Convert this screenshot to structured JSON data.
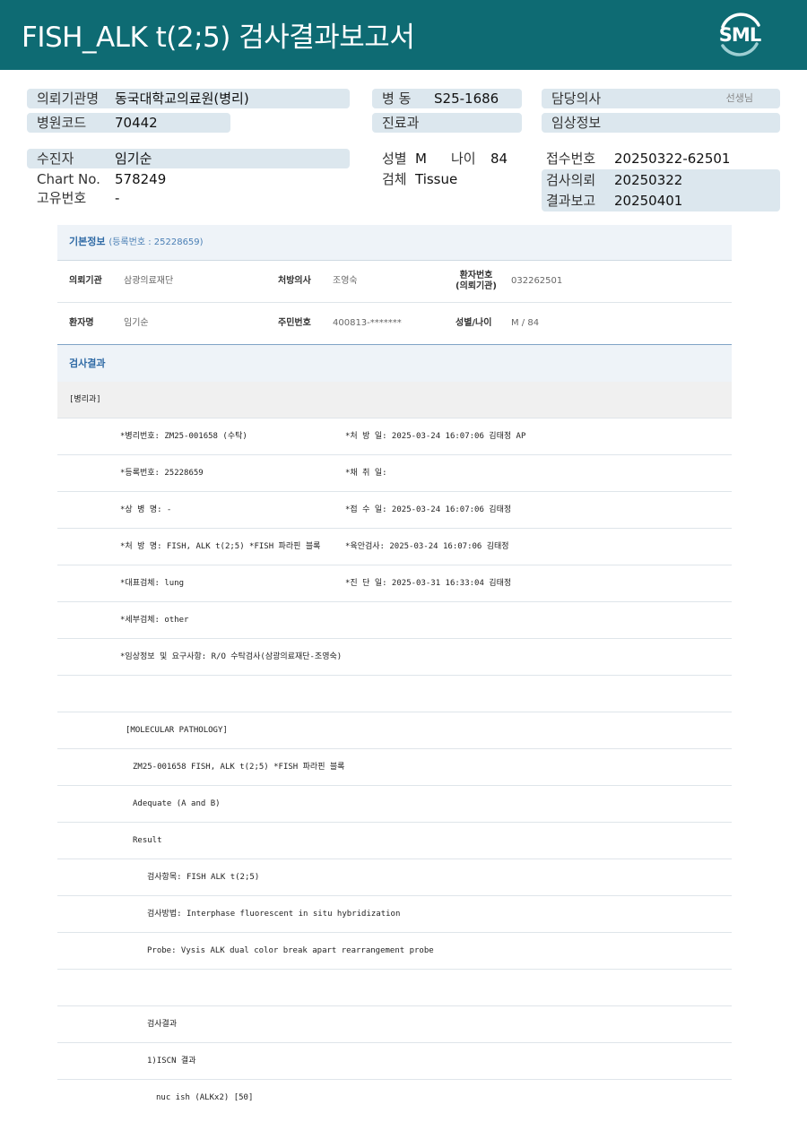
{
  "header": {
    "title": "FISH_ALK  t(2;5) 검사결과보고서",
    "logo": "SML"
  },
  "info": {
    "req_inst": {
      "label": "의뢰기관명",
      "value": "동국대학교의료원(병리)"
    },
    "hosp_code": {
      "label": "병원코드",
      "value": "70442"
    },
    "ward": {
      "label": "병 동",
      "value": "S25-1686"
    },
    "dept": {
      "label": "진료과",
      "value": ""
    },
    "doctor": {
      "label": "담당의사",
      "value": "",
      "suffix": "선생님"
    },
    "clinical": {
      "label": "임상정보",
      "value": ""
    },
    "patient": {
      "label": "수진자",
      "value": "임기순"
    },
    "chart": {
      "label": "Chart No.",
      "value": "578249"
    },
    "unique": {
      "label": "고유번호",
      "value": "-"
    },
    "sex": {
      "label": "성별",
      "value": "M"
    },
    "age": {
      "label": "나이",
      "value": "84"
    },
    "specimen": {
      "label": "검체",
      "value": "Tissue"
    },
    "receipt": {
      "label": "접수번호",
      "value": "20250322-62501"
    },
    "req_date": {
      "label": "검사의뢰",
      "value": "20250322"
    },
    "report_date": {
      "label": "결과보고",
      "value": "20250401"
    }
  },
  "basic": {
    "title": "기본정보",
    "reg": "(등록번호 : 25228659)",
    "inst_label": "의뢰기관",
    "inst_value": "삼광의료재단",
    "doc_label": "처방의사",
    "doc_value": "조영숙",
    "pno_label1": "환자번호",
    "pno_label2": "(의뢰기관)",
    "pno_value": "032262501",
    "name_label": "환자명",
    "name_value": "임기순",
    "rrn_label": "주민번호",
    "rrn_value": "400813-*******",
    "sexage_label": "성별/나이",
    "sexage_value": "M / 84"
  },
  "result": {
    "title": "검사결과",
    "dept_tag": "[병리과]",
    "left": [
      "*병리번호: ZM25-001658 (수탁)",
      "*등록번호: 25228659",
      "*상 병 명: -",
      "*처 방 명: FISH, ALK t(2;5) *FISH 파라핀 블록",
      "*대표검체: lung",
      "*세부검체: other",
      "*임상정보 및 요구사항: R/O 수탁검사(삼광의료재단-조영숙)"
    ],
    "right": [
      "*처 방 일: 2025-03-24 16:07:06  김태정 AP",
      "*채 취 일:",
      "*접 수 일: 2025-03-24 16:07:06  김태정",
      "*육안검사: 2025-03-24 16:07:06  김태정",
      "*진 단 일: 2025-03-31 16:33:04  김태정"
    ],
    "mol": [
      "[MOLECULAR PATHOLOGY]",
      "ZM25-001658     FISH, ALK t(2;5) *FISH 파라핀 블록",
      "Adequate (A and B)",
      "Result",
      "검사항목: FISH ALK t(2;5)",
      "검사방법: Interphase fluorescent in situ hybridization",
      "Probe: Vysis ALK dual color break apart rearrangement probe",
      "",
      "검사결과",
      "1)ISCN 결과",
      "nuc ish (ALKx2) [50]"
    ]
  }
}
